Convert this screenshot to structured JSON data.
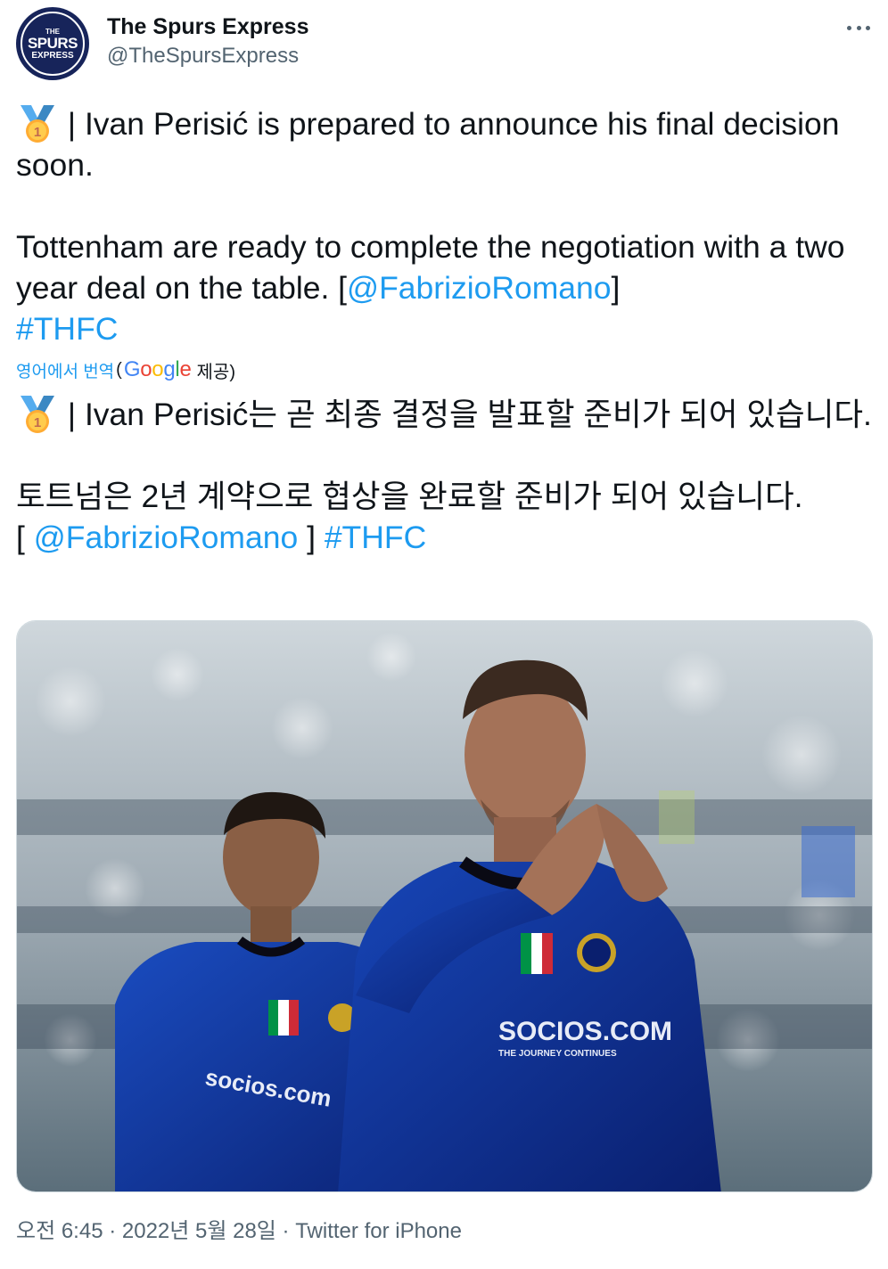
{
  "tweet": {
    "author": {
      "display_name": "The Spurs Express",
      "handle": "@TheSpursExpress",
      "avatar_text": {
        "top": "THE",
        "middle": "SPURS",
        "bottom": "EXPRESS"
      }
    },
    "more_icon": "more-horizontal-icon",
    "body": {
      "medal_icon": "1st-place-medal-icon",
      "line1_text": " | Ivan Perisić is prepared to announce his final decision soon.",
      "line2_text": "Tottenham are ready to complete the negotiation with a two year deal on the table. [",
      "mention": "@FabrizioRomano",
      "line2_close": "]",
      "hashtag": "#THFC"
    },
    "translation": {
      "link_label": "영어에서 번역",
      "open_paren": "(",
      "google_label": "Google",
      "provided_label": "제공)",
      "line1_text": " | Ivan Perisić는 곧 최종 결정을 발표할 준비가 되어 있습니다.",
      "line2_text": " 토트넘은 2년 계약으로 협상을 완료할 준비가 되어 있습니다.",
      "line3_open": "[ ",
      "mention": "@FabrizioRomano",
      "line3_close": " ] ",
      "hashtag": "#THFC"
    },
    "photo": {
      "shirt_sponsor": "SOCIOS.COM",
      "shirt_tagline": "THE JOURNEY CONTINUES"
    },
    "meta": {
      "time": "오전 6:45",
      "separator": " · ",
      "date": "2022년 5월 28일",
      "source": "Twitter for iPhone"
    }
  },
  "colors": {
    "link": "#1d9bf0",
    "text": "#0f1419",
    "secondary": "#536471",
    "inter_blue": "#0a2fa0"
  }
}
